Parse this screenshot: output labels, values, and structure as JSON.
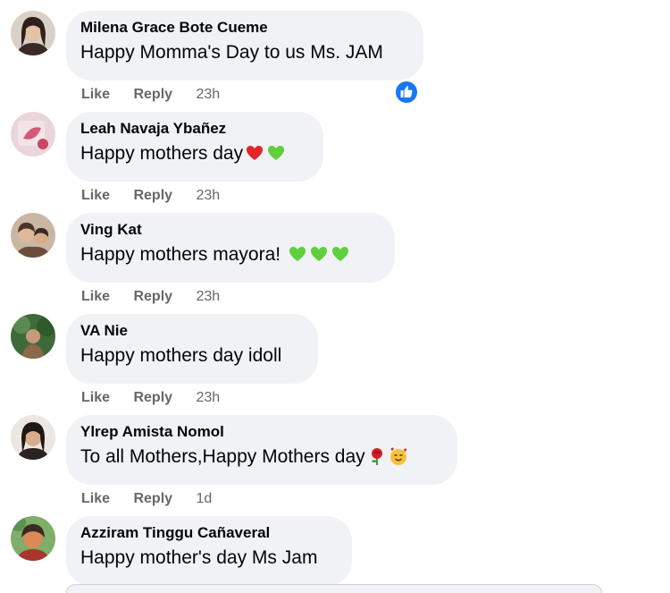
{
  "comments": [
    {
      "author": "Milena Grace Bote Cueme",
      "text": "Happy Momma's Day to us Ms. JAM",
      "emojis": [],
      "actions": {
        "like": "Like",
        "reply": "Reply",
        "time": "23h"
      },
      "reaction": "like-icon",
      "avatar_colors": [
        "#c9b6a8",
        "#3b2a25"
      ]
    },
    {
      "author": "Leah Navaja Ybañez",
      "text": "Happy mothers day",
      "emojis": [
        "red-heart-emoji",
        "green-heart-emoji"
      ],
      "actions": {
        "like": "Like",
        "reply": "Reply",
        "time": "23h"
      },
      "avatar_colors": [
        "#e6c9cf",
        "#d45a78"
      ]
    },
    {
      "author": "Ving Kat",
      "text": "Happy mothers mayora!",
      "emojis": [
        "green-heart-emoji",
        "green-heart-emoji",
        "green-heart-emoji"
      ],
      "actions": {
        "like": "Like",
        "reply": "Reply",
        "time": "23h"
      },
      "avatar_colors": [
        "#b9a48f",
        "#6b4d3b"
      ]
    },
    {
      "author": "VA Nie",
      "text": "Happy mothers day idoll",
      "emojis": [],
      "actions": {
        "like": "Like",
        "reply": "Reply",
        "time": "23h"
      },
      "avatar_colors": [
        "#3e6a3a",
        "#8a6a4a"
      ]
    },
    {
      "author": "Ylrep Amista Nomol",
      "text": "To all Mothers,Happy Mothers day",
      "emojis": [
        "rose-emoji",
        "smiling-hearts-emoji"
      ],
      "actions": {
        "like": "Like",
        "reply": "Reply",
        "time": "1d"
      },
      "avatar_colors": [
        "#e7e2de",
        "#2a2320"
      ]
    },
    {
      "author": "Azziram Tinggu Cañaveral",
      "text": "Happy mother's day Ms Jam",
      "emojis": [],
      "avatar_colors": [
        "#d98a55",
        "#3a2a22"
      ]
    }
  ],
  "colors": {
    "bubble": "#f0f2f5",
    "text": "#050505",
    "meta": "#65676b",
    "like_blue": "#1877f2"
  }
}
